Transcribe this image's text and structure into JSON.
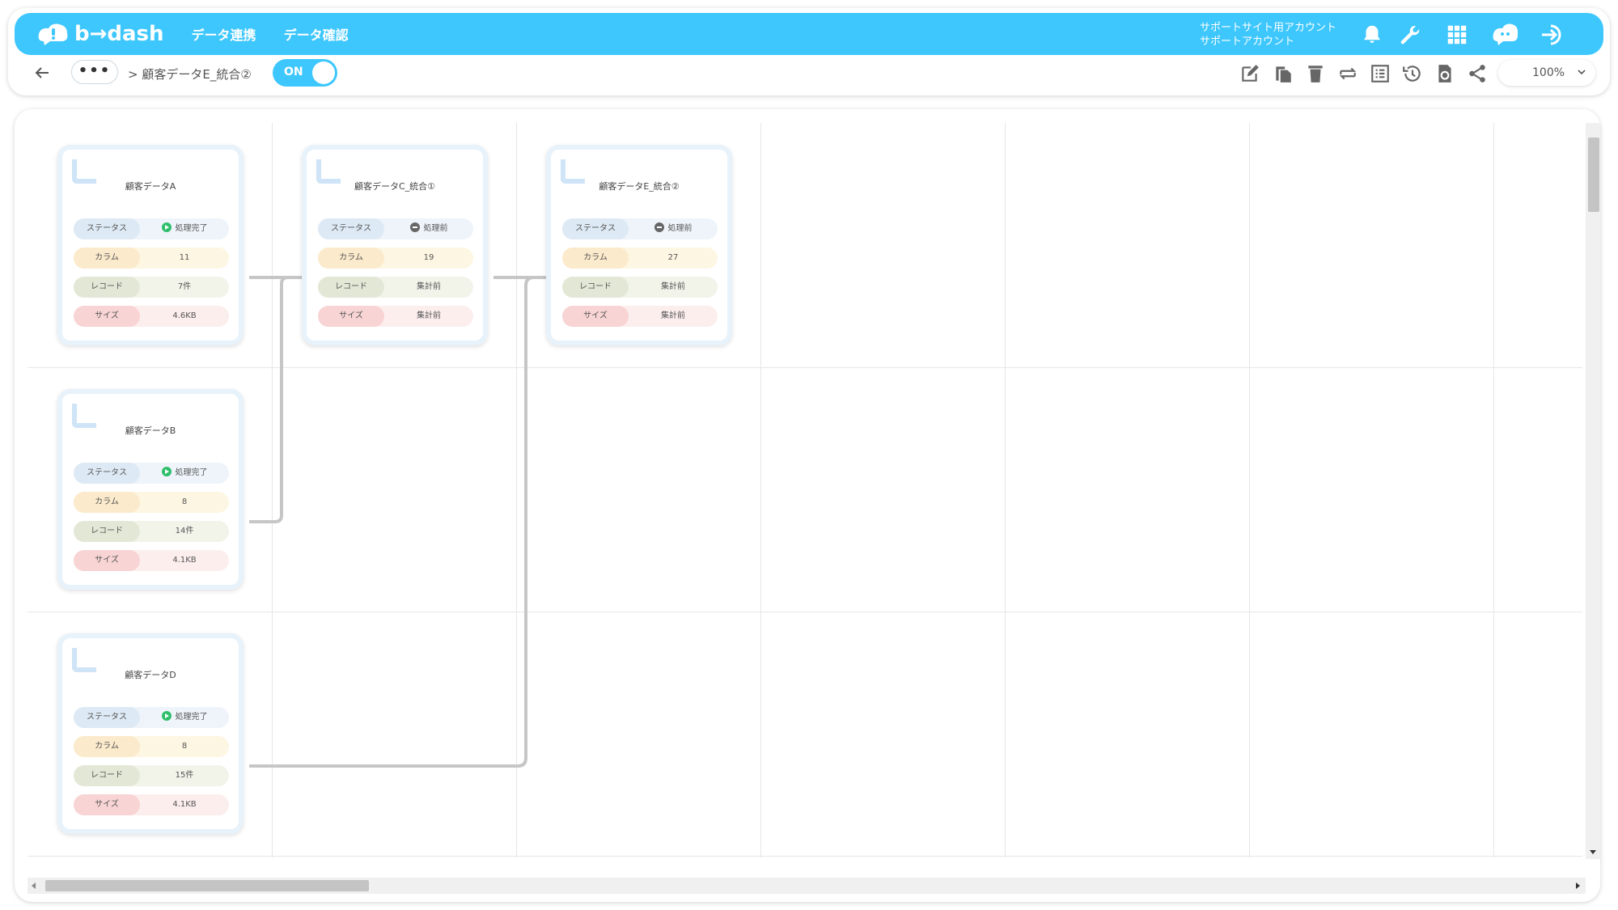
{
  "header": {
    "logo_text": "b→dash",
    "nav": [
      "データ連携",
      "データ確認"
    ],
    "account_line1": "サポートサイト用アカウント",
    "account_line2": "サポートアカウント",
    "icons": [
      "bell-icon",
      "wrench-icon",
      "apps-grid-icon",
      "chat-bubble-icon",
      "logout-icon"
    ]
  },
  "toolbar": {
    "dots": "•••",
    "breadcrumb": "> 顧客データE_統合②",
    "toggle_label": "ON",
    "zoom": "100%",
    "icons": [
      "edit-icon",
      "copy-icon",
      "delete-icon",
      "swap-icon",
      "list-icon",
      "history-icon",
      "refresh-icon",
      "share-icon"
    ]
  },
  "labels": {
    "status": "ステータス",
    "column": "カラム",
    "record": "レコード",
    "size": "サイズ"
  },
  "nodes": [
    {
      "title": "顧客データA",
      "status": "処理完了",
      "status_kind": "done",
      "column": "11",
      "record": "7件",
      "size": "4.6KB"
    },
    {
      "title": "顧客データB",
      "status": "処理完了",
      "status_kind": "done",
      "column": "8",
      "record": "14件",
      "size": "4.1KB"
    },
    {
      "title": "顧客データD",
      "status": "処理完了",
      "status_kind": "done",
      "column": "8",
      "record": "15件",
      "size": "4.1KB"
    },
    {
      "title": "顧客データC_統合①",
      "status": "処理前",
      "status_kind": "pending",
      "column": "19",
      "record": "集計前",
      "size": "集計前"
    },
    {
      "title": "顧客データE_統合②",
      "status": "処理前",
      "status_kind": "pending",
      "column": "27",
      "record": "集計前",
      "size": "集計前"
    }
  ],
  "colors": {
    "brand": "#3ec7fd",
    "done": "#2fbf6b",
    "connector": "#c6c6c6"
  }
}
